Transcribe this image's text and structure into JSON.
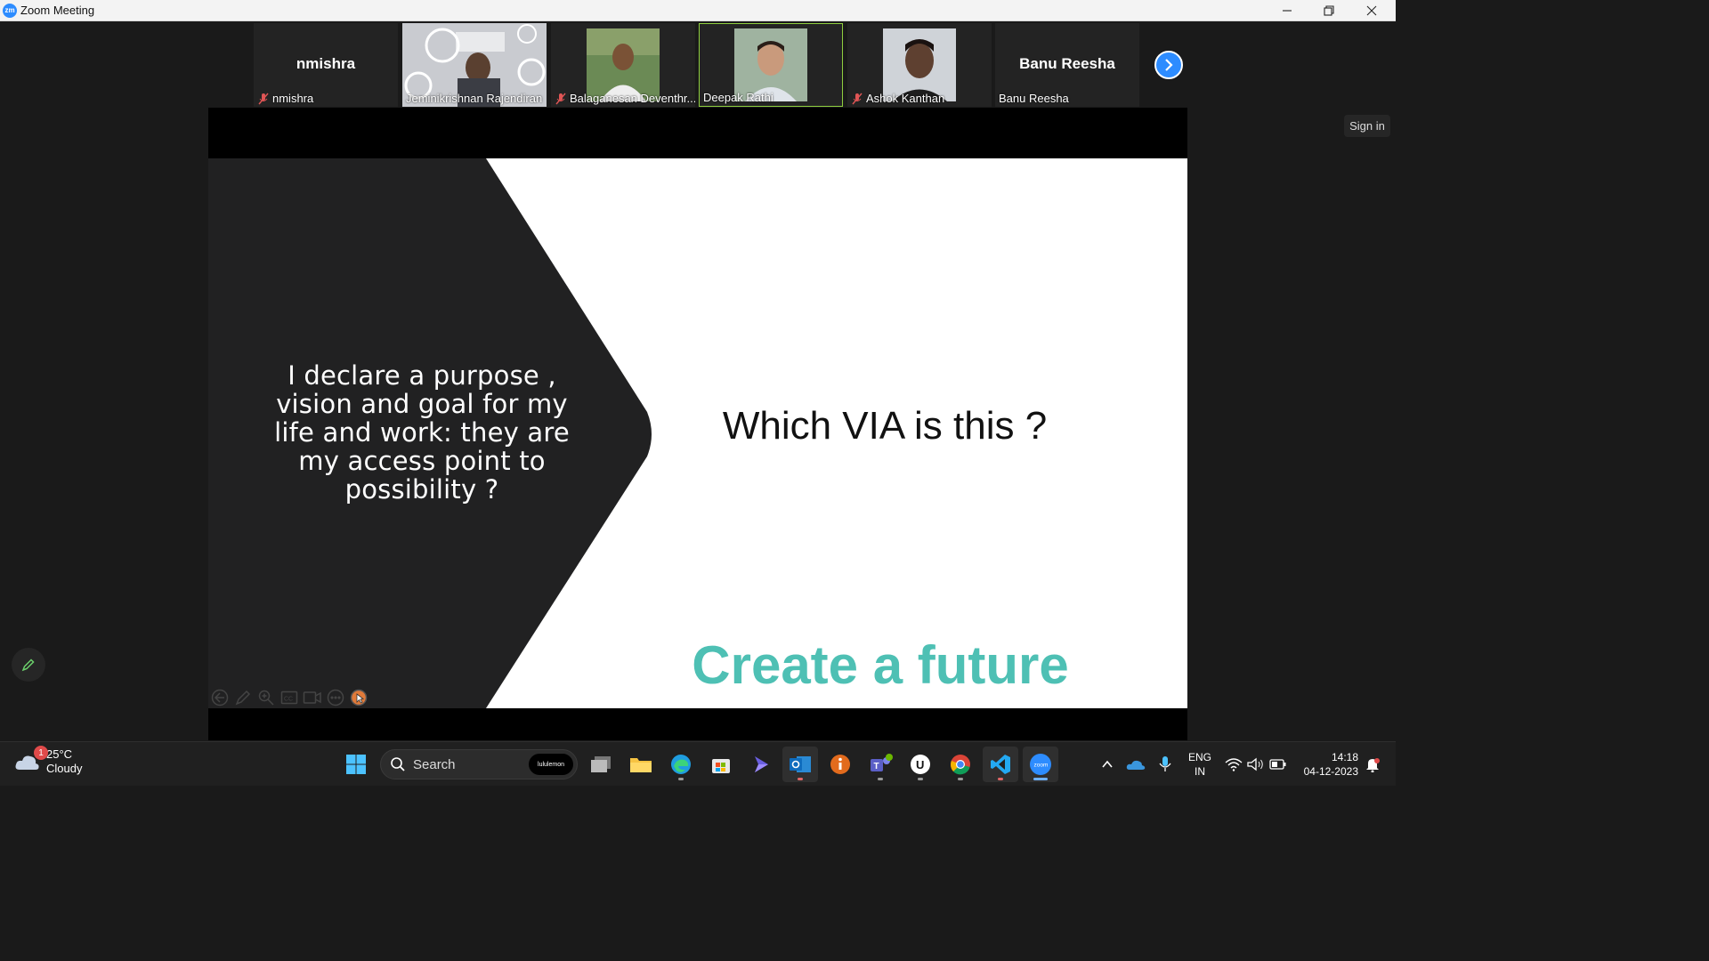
{
  "window": {
    "title": "Zoom Meeting",
    "logo_text": "zm"
  },
  "participants": [
    {
      "name": "nmishra",
      "big_name": "nmishra",
      "muted": true,
      "video": false
    },
    {
      "name": "Jeminikrishnan Rajendiran",
      "muted": false,
      "video": true
    },
    {
      "name": "Balaganesan Deventhr...",
      "muted": true,
      "video": true
    },
    {
      "name": "Deepak Rathi",
      "muted": false,
      "video": true,
      "active_speaker": true
    },
    {
      "name": "Ashok Kanthan",
      "muted": true,
      "video": true
    },
    {
      "name": "Banu Reesha",
      "big_name": "Banu Reesha",
      "muted": false,
      "video": false
    }
  ],
  "slide": {
    "left_text": "I declare a purpose , vision and goal for my life and work: they are my access point to possibility  ?",
    "question": "Which VIA is this ?",
    "footer": "Create a future",
    "footer_color": "#4ec0b4"
  },
  "overlay": {
    "sign_in": "Sign in"
  },
  "taskbar": {
    "weather_temp": "25°C",
    "weather_desc": "Cloudy",
    "weather_badge": "1",
    "search_label": "Search",
    "search_badge": "lululemon",
    "lang_top": "ENG",
    "lang_bottom": "IN",
    "time": "14:18",
    "date": "04-12-2023"
  },
  "colors": {
    "accent": "#2d8cff",
    "active_border": "#8fcf3f",
    "muted_mic": "#e05555"
  }
}
